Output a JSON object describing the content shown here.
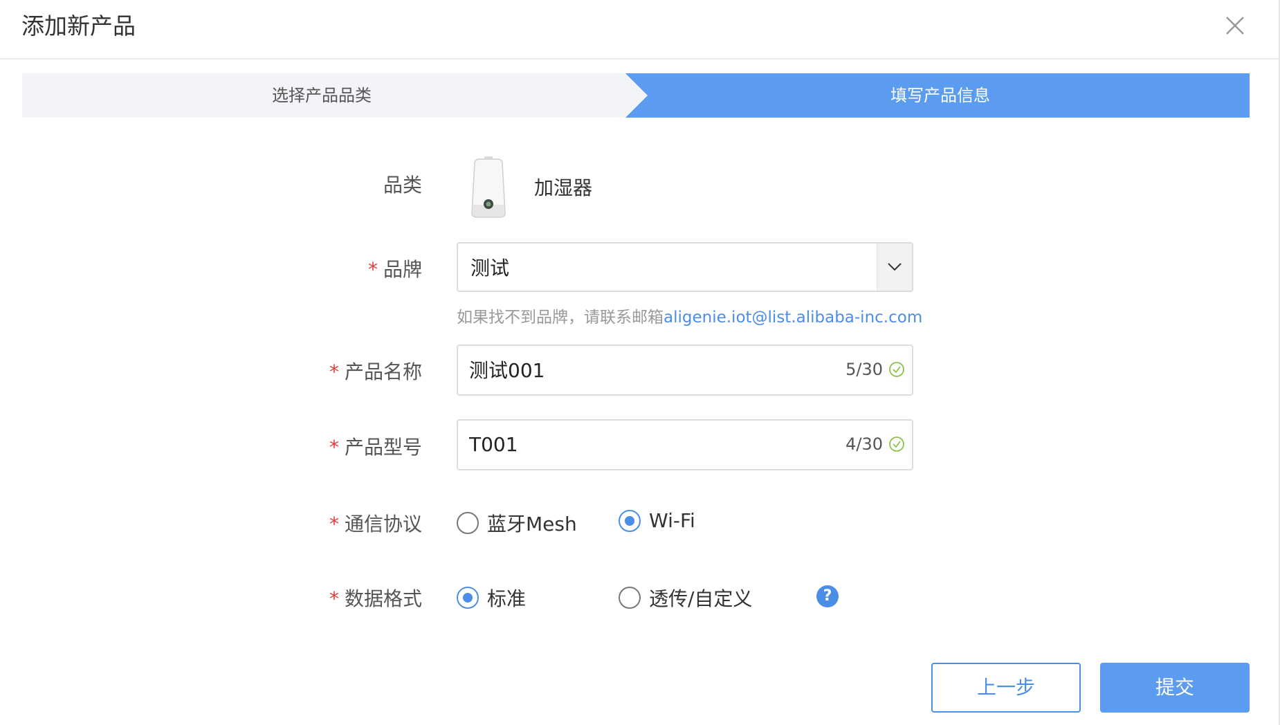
{
  "dialog": {
    "title": "添加新产品",
    "close_icon": "close-icon"
  },
  "steps": [
    {
      "label": "选择产品品类",
      "active": false
    },
    {
      "label": "填写产品信息",
      "active": true
    }
  ],
  "colors": {
    "accent": "#4a8ee8",
    "step_active": "#5b9cf0",
    "step_inactive": "#f3f4f7",
    "required": "#e8383d"
  },
  "form": {
    "category": {
      "label": "品类",
      "value": "加湿器",
      "icon": "humidifier-image"
    },
    "brand": {
      "required_mark": "*",
      "label": "品牌",
      "value": "测试",
      "dropdown_icon": "chevron-down-icon",
      "hint_text": "如果找不到品牌，请联系邮箱",
      "hint_email": "aligenie.iot@list.alibaba-inc.com"
    },
    "product_name": {
      "required_mark": "*",
      "label": "产品名称",
      "value": "测试001",
      "counter": "5/30",
      "status_icon": "check-circle-icon"
    },
    "product_model": {
      "required_mark": "*",
      "label": "产品型号",
      "value": "T001",
      "counter": "4/30",
      "status_icon": "check-circle-icon"
    },
    "protocol": {
      "required_mark": "*",
      "label": "通信协议",
      "options": [
        {
          "label": "蓝牙Mesh",
          "checked": false
        },
        {
          "label": "Wi-Fi",
          "checked": true
        }
      ]
    },
    "data_format": {
      "required_mark": "*",
      "label": "数据格式",
      "options": [
        {
          "label": "标准",
          "checked": true
        },
        {
          "label": "透传/自定义",
          "checked": false
        }
      ],
      "help_icon": "question-icon",
      "help_text": "?"
    }
  },
  "footer": {
    "prev_label": "上一步",
    "submit_label": "提交"
  }
}
